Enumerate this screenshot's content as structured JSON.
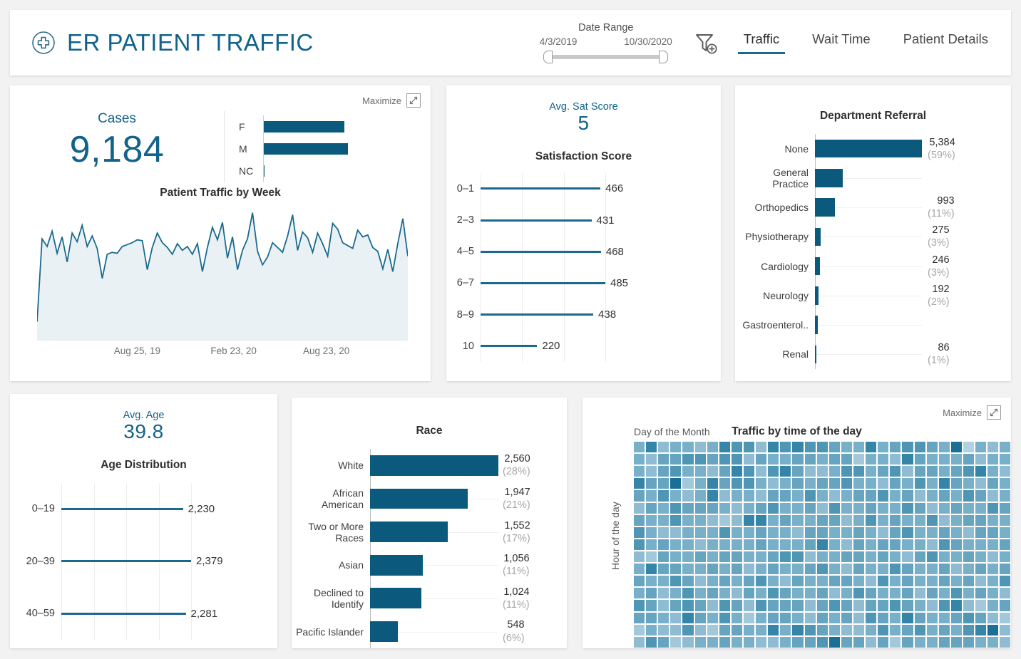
{
  "header": {
    "logo_icon": "medical-cross-circle-icon",
    "title": "ER PATIENT TRAFFIC",
    "date_range": {
      "label": "Date Range",
      "start": "4/3/2019",
      "end": "10/30/2020"
    },
    "filter_icon": "filter-add-icon",
    "tabs": [
      {
        "label": "Traffic",
        "active": true
      },
      {
        "label": "Wait Time",
        "active": false
      },
      {
        "label": "Patient Details",
        "active": false
      }
    ]
  },
  "maximize_label": "Maximize",
  "maximize_icon": "expand-diagonal-icon",
  "cases_card": {
    "kpi_label": "Cases",
    "kpi_value": "9,184",
    "gender": {
      "categories": [
        "F",
        "M",
        "NC"
      ],
      "values": [
        4472,
        4688,
        24
      ],
      "value_labels": [
        "4,472",
        "4,688",
        "24"
      ]
    },
    "line_chart": {
      "title": "Patient Traffic by Week",
      "x_tick_labels": [
        "Aug 25, 19",
        "Feb 23, 20",
        "Aug 23, 20"
      ]
    }
  },
  "sat_card": {
    "kpi_label": "Avg. Sat Score",
    "kpi_value": "5",
    "chart_title": "Satisfaction Score"
  },
  "dept_card": {
    "chart_title": "Department Referral"
  },
  "age_card": {
    "kpi_label": "Avg. Age",
    "kpi_value": "39.8",
    "chart_title": "Age Distribution"
  },
  "race_card": {
    "chart_title": "Race"
  },
  "heat_card": {
    "x_axis_label": "Day of the Month",
    "y_axis_label": "Hour of the day",
    "title": "Traffic by time of the day"
  },
  "colors": {
    "accent_teal": "#0b5a7d",
    "brand_blue": "#12628a",
    "line_stroke": "#1a6a8e",
    "area_fill": "#eaf1f5",
    "page_bg": "#f2f2f2",
    "card_bg": "#ffffff",
    "muted_text": "#a8a8a8",
    "heat_min": "#aecfdf",
    "heat_max": "#1b6e96"
  },
  "chart_data": [
    {
      "id": "gender_bars",
      "type": "bar",
      "title": "Cases by Gender",
      "orientation": "horizontal",
      "categories": [
        "F",
        "M",
        "NC"
      ],
      "values": [
        4472,
        4688,
        24
      ],
      "xlabel": "",
      "ylabel": "",
      "xlim": [
        0,
        4688
      ],
      "grid": false,
      "legend": "none"
    },
    {
      "id": "patient_traffic_by_week",
      "type": "area",
      "title": "Patient Traffic by Week",
      "xlabel": "",
      "ylabel": "",
      "x_tick_labels": [
        "Aug 25, 19",
        "Feb 23, 20",
        "Aug 23, 20"
      ],
      "x_tick_positions": [
        0.27,
        0.53,
        0.78
      ],
      "grid": false,
      "legend": "none",
      "ylim": [
        0,
        130
      ],
      "values": [
        18,
        104,
        96,
        112,
        89,
        106,
        80,
        110,
        101,
        118,
        96,
        107,
        94,
        63,
        88,
        90,
        89,
        96,
        98,
        100,
        103,
        102,
        72,
        95,
        110,
        100,
        95,
        88,
        99,
        92,
        96,
        88,
        99,
        70,
        95,
        116,
        103,
        121,
        84,
        106,
        72,
        92,
        104,
        131,
        91,
        77,
        85,
        100,
        95,
        90,
        107,
        129,
        92,
        111,
        105,
        90,
        110,
        99,
        86,
        120,
        114,
        100,
        97,
        94,
        113,
        106,
        108,
        95,
        91,
        73,
        93,
        70,
        99,
        125,
        86
      ]
    },
    {
      "id": "satisfaction_score",
      "type": "bar",
      "title": "Satisfaction Score",
      "orientation": "horizontal",
      "style": "lollipop",
      "categories": [
        "0–1",
        "2–3",
        "4–5",
        "6–7",
        "8–9",
        "10"
      ],
      "values": [
        466,
        431,
        468,
        485,
        438,
        220
      ],
      "value_labels": [
        "466",
        "431",
        "468",
        "485",
        "438",
        "220"
      ],
      "xlim": [
        0,
        485
      ],
      "grid": true,
      "legend": "none"
    },
    {
      "id": "department_referral",
      "type": "bar",
      "title": "Department Referral",
      "orientation": "horizontal",
      "categories": [
        "None",
        "General Practice",
        "Orthopedics",
        "Physiotherapy",
        "Cardiology",
        "Neurology",
        "Gastroenterol..",
        "Renal"
      ],
      "values": [
        5384,
        1403,
        993,
        275,
        246,
        192,
        155,
        86
      ],
      "value_labels": [
        "5,384",
        "",
        "993",
        "275",
        "246",
        "192",
        "",
        "86"
      ],
      "percent_labels": [
        "(59%)",
        "",
        "(11%)",
        "(3%)",
        "(3%)",
        "(2%)",
        "",
        "(1%)"
      ],
      "xlim": [
        0,
        5384
      ],
      "grid": true,
      "legend": "none"
    },
    {
      "id": "age_distribution",
      "type": "bar",
      "title": "Age Distribution",
      "orientation": "horizontal",
      "style": "lollipop",
      "categories": [
        "0–19",
        "20–39",
        "40–59"
      ],
      "values": [
        2230,
        2379,
        2281
      ],
      "value_labels": [
        "2,230",
        "2,379",
        "2,281"
      ],
      "xlim": [
        0,
        2379
      ],
      "grid": true,
      "legend": "none",
      "note": "card clipped at bottom; further age bands not visible"
    },
    {
      "id": "race",
      "type": "bar",
      "title": "Race",
      "orientation": "horizontal",
      "categories": [
        "White",
        "African American",
        "Two or More Races",
        "Asian",
        "Declined to Identify",
        "Pacific Islander"
      ],
      "values": [
        2560,
        1947,
        1552,
        1056,
        1024,
        548
      ],
      "value_labels": [
        "2,560",
        "1,947",
        "1,552",
        "1,056",
        "1,024",
        "548"
      ],
      "percent_labels": [
        "(28%)",
        "(21%)",
        "(17%)",
        "(11%)",
        "(11%)",
        "(6%)"
      ],
      "xlim": [
        0,
        2560
      ],
      "grid": true,
      "legend": "none"
    },
    {
      "id": "traffic_by_time_of_day",
      "type": "heatmap",
      "title": "Traffic by time of the day",
      "xlabel": "Day of the Month",
      "ylabel": "Hour of the day",
      "columns": 31,
      "rows": 17,
      "grid": false,
      "legend": "none",
      "intensity_rows": [
        [
          5,
          8,
          4,
          5,
          5,
          4,
          5,
          8,
          7,
          7,
          4,
          8,
          7,
          8,
          7,
          7,
          6,
          5,
          5,
          8,
          5,
          6,
          7,
          7,
          6,
          5,
          9,
          2,
          5,
          4,
          5
        ],
        [
          5,
          4,
          6,
          6,
          7,
          7,
          6,
          7,
          7,
          4,
          6,
          5,
          5,
          6,
          6,
          5,
          6,
          6,
          3,
          5,
          5,
          4,
          8,
          6,
          5,
          5,
          5,
          6,
          4,
          5,
          5
        ],
        [
          5,
          4,
          6,
          7,
          5,
          5,
          4,
          6,
          8,
          7,
          4,
          7,
          8,
          6,
          4,
          4,
          5,
          7,
          7,
          5,
          6,
          7,
          4,
          6,
          6,
          5,
          6,
          7,
          8,
          5,
          4
        ],
        [
          8,
          6,
          6,
          9,
          3,
          5,
          8,
          6,
          7,
          7,
          5,
          4,
          5,
          6,
          5,
          6,
          6,
          7,
          5,
          5,
          4,
          6,
          5,
          7,
          5,
          8,
          6,
          5,
          4,
          6,
          5
        ],
        [
          6,
          5,
          7,
          5,
          4,
          5,
          8,
          4,
          5,
          5,
          4,
          6,
          6,
          5,
          7,
          5,
          4,
          5,
          6,
          6,
          7,
          5,
          6,
          4,
          5,
          6,
          5,
          7,
          6,
          4,
          5
        ],
        [
          4,
          6,
          5,
          7,
          6,
          6,
          6,
          5,
          4,
          5,
          6,
          7,
          5,
          5,
          6,
          4,
          7,
          5,
          5,
          6,
          5,
          5,
          7,
          6,
          4,
          5,
          6,
          5,
          5,
          7,
          6
        ],
        [
          6,
          5,
          5,
          7,
          5,
          5,
          4,
          3,
          4,
          8,
          8,
          5,
          6,
          5,
          5,
          6,
          6,
          4,
          5,
          7,
          5,
          6,
          5,
          5,
          7,
          4,
          5,
          6,
          6,
          5,
          5
        ],
        [
          7,
          5,
          4,
          4,
          5,
          5,
          5,
          7,
          5,
          5,
          6,
          5,
          5,
          4,
          6,
          6,
          5,
          5,
          6,
          5,
          4,
          6,
          7,
          5,
          5,
          6,
          5,
          4,
          6,
          6,
          5
        ],
        [
          7,
          5,
          6,
          5,
          5,
          4,
          5,
          5,
          5,
          5,
          6,
          5,
          5,
          5,
          6,
          8,
          5,
          4,
          6,
          5,
          6,
          6,
          5,
          5,
          4,
          7,
          6,
          5,
          5,
          5,
          6
        ],
        [
          4,
          3,
          6,
          5,
          5,
          6,
          5,
          6,
          6,
          5,
          5,
          6,
          7,
          7,
          4,
          5,
          5,
          6,
          6,
          5,
          6,
          5,
          4,
          6,
          7,
          5,
          5,
          6,
          5,
          4,
          5
        ],
        [
          5,
          8,
          6,
          6,
          5,
          5,
          6,
          5,
          6,
          4,
          5,
          6,
          5,
          5,
          6,
          7,
          5,
          4,
          6,
          5,
          5,
          7,
          6,
          5,
          5,
          6,
          4,
          5,
          6,
          5,
          6
        ],
        [
          6,
          5,
          5,
          7,
          6,
          4,
          5,
          6,
          5,
          6,
          7,
          5,
          4,
          6,
          5,
          5,
          6,
          6,
          5,
          4,
          7,
          5,
          6,
          5,
          5,
          6,
          5,
          6,
          4,
          5,
          7
        ],
        [
          5,
          6,
          4,
          5,
          7,
          5,
          6,
          5,
          4,
          6,
          5,
          7,
          6,
          5,
          5,
          6,
          4,
          5,
          7,
          6,
          5,
          5,
          6,
          4,
          6,
          5,
          7,
          5,
          6,
          5,
          4
        ],
        [
          7,
          6,
          4,
          6,
          7,
          6,
          4,
          7,
          6,
          4,
          7,
          6,
          6,
          6,
          4,
          6,
          7,
          6,
          4,
          6,
          6,
          7,
          6,
          5,
          4,
          7,
          8,
          4,
          3,
          5,
          6
        ],
        [
          6,
          6,
          5,
          4,
          8,
          6,
          5,
          7,
          5,
          3,
          5,
          6,
          6,
          5,
          4,
          6,
          5,
          6,
          4,
          7,
          6,
          5,
          8,
          6,
          5,
          5,
          6,
          7,
          6,
          4,
          3
        ],
        [
          3,
          5,
          4,
          4,
          7,
          4,
          3,
          6,
          6,
          5,
          5,
          8,
          5,
          8,
          7,
          6,
          5,
          4,
          4,
          5,
          7,
          5,
          6,
          7,
          5,
          6,
          5,
          7,
          8,
          9,
          4
        ],
        [
          4,
          7,
          6,
          3,
          4,
          5,
          5,
          6,
          5,
          5,
          4,
          4,
          5,
          6,
          6,
          7,
          9,
          6,
          6,
          4,
          6,
          3,
          6,
          5,
          5,
          6,
          6,
          6,
          5,
          5,
          4
        ]
      ]
    }
  ]
}
